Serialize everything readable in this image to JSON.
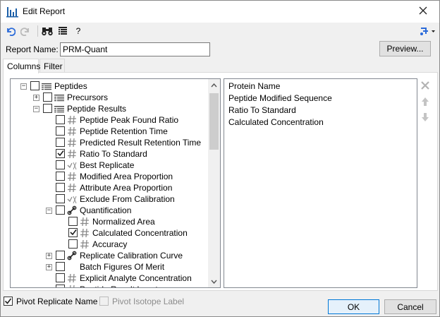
{
  "window": {
    "title": "Edit Report",
    "help_label": "?"
  },
  "report_name": {
    "label": "Report Name:",
    "value": "PRM-Quant",
    "preview_label": "Preview..."
  },
  "tabs": [
    {
      "label": "Columns",
      "active": true
    },
    {
      "label": "Filter",
      "active": false
    }
  ],
  "tree": {
    "rows": [
      {
        "label": "Peptides",
        "expander": "minus",
        "checked": false,
        "icon": "table-icon"
      },
      {
        "label": "Precursors",
        "expander": "plus",
        "checked": false,
        "icon": "table-icon"
      },
      {
        "label": "Peptide Results",
        "expander": "minus",
        "checked": false,
        "icon": "table-icon"
      },
      {
        "label": "Peptide Peak Found Ratio",
        "expander": "",
        "checked": false,
        "icon": "number-icon"
      },
      {
        "label": "Peptide Retention Time",
        "expander": "",
        "checked": false,
        "icon": "number-icon"
      },
      {
        "label": "Predicted Result Retention Time",
        "expander": "",
        "checked": false,
        "icon": "number-icon"
      },
      {
        "label": "Ratio To Standard",
        "expander": "",
        "checked": true,
        "icon": "number-icon"
      },
      {
        "label": "Best Replicate",
        "expander": "",
        "checked": false,
        "icon": "boolean-icon"
      },
      {
        "label": "Modified Area Proportion",
        "expander": "",
        "checked": false,
        "icon": "number-icon"
      },
      {
        "label": "Attribute Area Proportion",
        "expander": "",
        "checked": false,
        "icon": "number-icon"
      },
      {
        "label": "Exclude From Calibration",
        "expander": "",
        "checked": false,
        "icon": "boolean-icon"
      },
      {
        "label": "Quantification",
        "expander": "minus",
        "checked": false,
        "icon": "link-icon"
      },
      {
        "label": "Normalized Area",
        "expander": "",
        "checked": false,
        "icon": "number-icon"
      },
      {
        "label": "Calculated Concentration",
        "expander": "",
        "checked": true,
        "icon": "number-icon"
      },
      {
        "label": "Accuracy",
        "expander": "",
        "checked": false,
        "icon": "number-icon"
      },
      {
        "label": "Replicate Calibration Curve",
        "expander": "plus",
        "checked": false,
        "icon": "link-icon"
      },
      {
        "label": "Batch Figures Of Merit",
        "expander": "plus",
        "checked": false,
        "icon": ""
      },
      {
        "label": "Explicit Analyte Concentration",
        "expander": "",
        "checked": false,
        "icon": "number-icon"
      },
      {
        "label": "Peptide Result Locator",
        "expander": "",
        "checked": false,
        "icon": "number-icon"
      }
    ]
  },
  "selected_columns": [
    "Protein Name",
    "Peptide Modified Sequence",
    "Ratio To Standard",
    "Calculated Concentration"
  ],
  "footer": {
    "pivot_replicate_label": "Pivot Replicate Name",
    "pivot_replicate_checked": true,
    "pivot_isotope_label": "Pivot Isotope Label",
    "pivot_isotope_checked": false,
    "ok_label": "OK",
    "cancel_label": "Cancel"
  },
  "colors": {
    "accent": "#0078d7",
    "undo_blue": "#2a6ad9",
    "check_fill": "#1f1f1f"
  }
}
